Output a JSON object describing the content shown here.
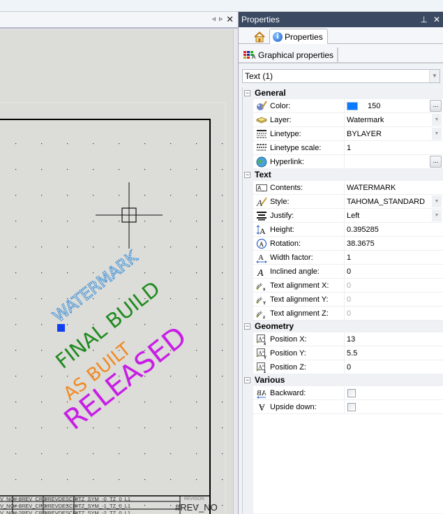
{
  "document": {
    "nav_prev": "◃",
    "nav_next": "▹",
    "close": "✕",
    "watermarks": [
      {
        "text": "WATERMARK",
        "color": "#3a8fd8",
        "style": "hatched"
      },
      {
        "text": "FINAL BUILD",
        "color": "#1f8a1f",
        "style": "solid"
      },
      {
        "text": "AS BUILT",
        "color": "#f08a24",
        "style": "solid"
      },
      {
        "text": "RELEASED",
        "color": "#c81ee6",
        "style": "solid"
      }
    ],
    "title_block": {
      "rows": [
        [
          "V_NO",
          "#-8REV_CRE",
          "#REVDESCR",
          "#TZ_SYM",
          "_-0_TZ_0_L1"
        ],
        [
          "V_NO",
          "#-8REV_CRE",
          "#REVDESCR",
          "#TZ_SYM",
          "_-1_TZ_0_L1"
        ],
        [
          "V_NO",
          "#-2REV_CRE",
          "#REVDESCR",
          "#TZ_SYM",
          "_-2_TZ_0_L1"
        ]
      ],
      "revision_label": "REVISION",
      "revision_value": "#REV_NO"
    }
  },
  "properties": {
    "title": "Properties",
    "pin": "⊥",
    "close": "✕",
    "tabs": [
      {
        "icon": "home-icon",
        "label": ""
      },
      {
        "icon": "info-icon",
        "label": "Properties"
      }
    ],
    "subtab": "Graphical properties",
    "selection": "Text (1)",
    "categories": [
      {
        "name": "General",
        "rows": [
          {
            "label": "Color:",
            "value": "150",
            "color": "#0a7bff",
            "icon": "color-brush-icon",
            "button": "..."
          },
          {
            "label": "Layer:",
            "value": "Watermark",
            "icon": "layer-icon",
            "dropdown": true
          },
          {
            "label": "Linetype:",
            "value": "BYLAYER",
            "icon": "linetype-icon",
            "dropdown": true
          },
          {
            "label": "Linetype scale:",
            "value": "1",
            "icon": "linetype-scale-icon"
          },
          {
            "label": "Hyperlink:",
            "value": "",
            "icon": "globe-icon",
            "button": "..."
          }
        ]
      },
      {
        "name": "Text",
        "rows": [
          {
            "label": "Contents:",
            "value": "WATERMARK",
            "icon": "text-contents-icon"
          },
          {
            "label": "Style:",
            "value": "TAHOMA_STANDARD",
            "icon": "text-style-icon",
            "dropdown": true
          },
          {
            "label": "Justify:",
            "value": "Left",
            "icon": "justify-icon",
            "dropdown": true
          },
          {
            "label": "Height:",
            "value": "0.395285",
            "icon": "text-height-icon"
          },
          {
            "label": "Rotation:",
            "value": "38.3675",
            "icon": "rotation-icon"
          },
          {
            "label": "Width factor:",
            "value": "1",
            "icon": "width-factor-icon"
          },
          {
            "label": "Inclined angle:",
            "value": "0",
            "icon": "inclined-angle-icon"
          },
          {
            "label": "Text alignment X:",
            "value": "0",
            "icon": "text-align-x-icon",
            "disabled": true
          },
          {
            "label": "Text alignment Y:",
            "value": "0",
            "icon": "text-align-y-icon",
            "disabled": true
          },
          {
            "label": "Text alignment Z:",
            "value": "0",
            "icon": "text-align-z-icon",
            "disabled": true
          }
        ]
      },
      {
        "name": "Geometry",
        "rows": [
          {
            "label": "Position X:",
            "value": "13",
            "icon": "position-x-icon"
          },
          {
            "label": "Position Y:",
            "value": "5.5",
            "icon": "position-y-icon"
          },
          {
            "label": "Position Z:",
            "value": "0",
            "icon": "position-z-icon"
          }
        ]
      },
      {
        "name": "Various",
        "rows": [
          {
            "label": "Backward:",
            "checkbox": false,
            "icon": "backward-icon"
          },
          {
            "label": "Upside down:",
            "checkbox": false,
            "icon": "upside-down-icon"
          }
        ]
      }
    ]
  }
}
